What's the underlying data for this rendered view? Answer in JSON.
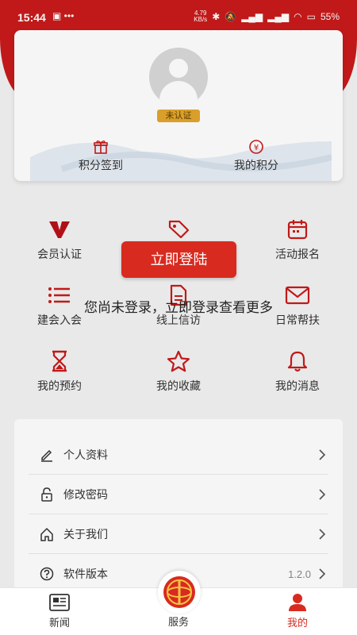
{
  "status": {
    "time": "15:44",
    "net_speed": "4.79",
    "net_unit": "KB/s",
    "battery": "55%"
  },
  "profile": {
    "badge": "未认证",
    "checkin_label": "积分签到",
    "points_label": "我的积分"
  },
  "grid": {
    "member_auth": "会员认证",
    "activity_signup": "活动报名",
    "join_union": "建会入会",
    "online_petition": "线上信访",
    "daily_help": "日常帮扶",
    "my_reservation": "我的预约",
    "my_favorites": "我的收藏",
    "my_messages": "我的消息"
  },
  "list": {
    "personal_info": "个人资料",
    "change_password": "修改密码",
    "about_us": "关于我们",
    "app_version": "软件版本",
    "version_value": "1.2.0"
  },
  "login": {
    "button": "立即登陆",
    "tip": "您尚未登录，立即登录查看更多"
  },
  "nav": {
    "news": "新闻",
    "service": "服务",
    "mine": "我的"
  },
  "colors": {
    "brand_red": "#c91b1b",
    "button_red": "#d92a1f",
    "badge_gold": "#e3a62c"
  }
}
